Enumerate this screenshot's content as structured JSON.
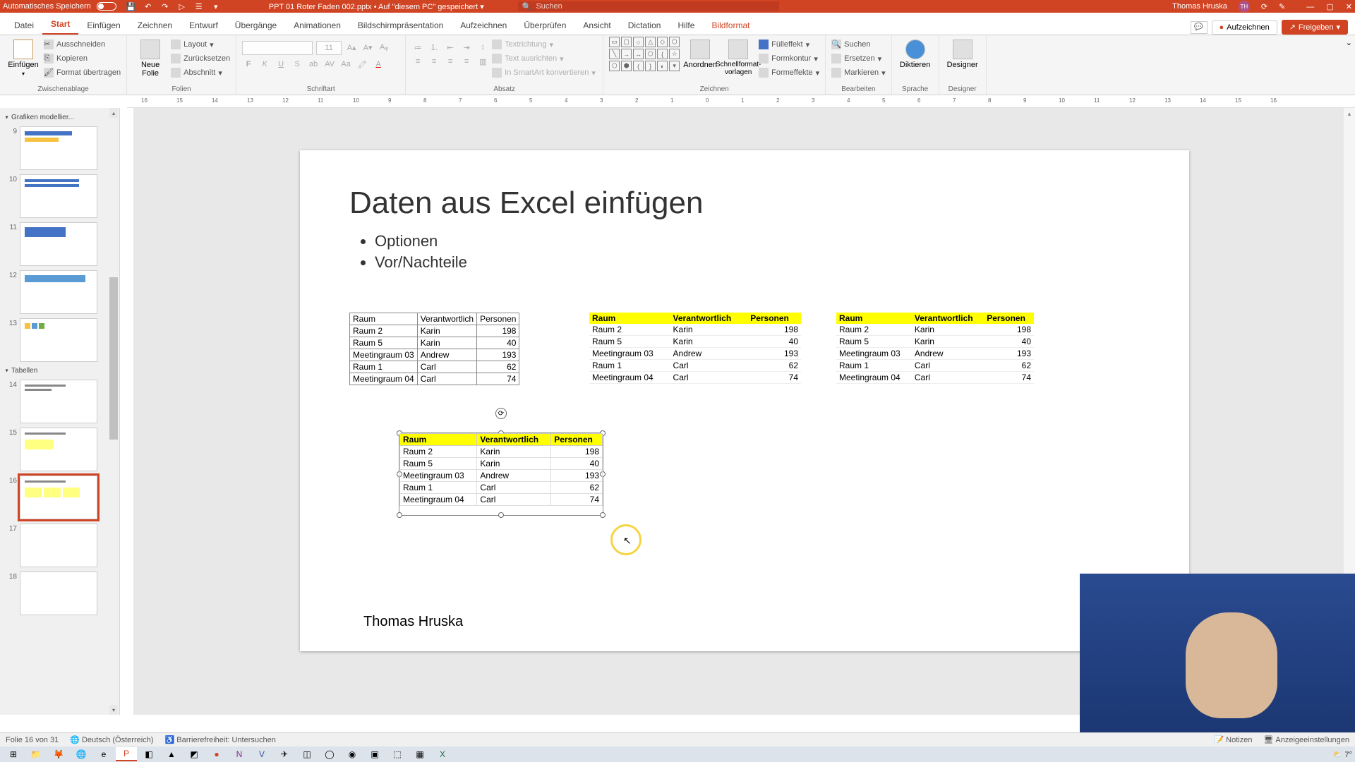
{
  "titlebar": {
    "autosave": "Automatisches Speichern",
    "filename": "PPT 01 Roter Faden 002.pptx",
    "saved_hint": "Auf \"diesem PC\" gespeichert",
    "search_placeholder": "Suchen",
    "user": "Thomas Hruska",
    "user_initials": "TH"
  },
  "tabs": [
    "Datei",
    "Start",
    "Einfügen",
    "Zeichnen",
    "Entwurf",
    "Übergänge",
    "Animationen",
    "Bildschirmpräsentation",
    "Aufzeichnen",
    "Überprüfen",
    "Ansicht",
    "Dictation",
    "Hilfe",
    "Bildformat"
  ],
  "active_tab": "Start",
  "context_tab": "Bildformat",
  "tab_right": {
    "record": "Aufzeichnen",
    "share": "Freigeben"
  },
  "ribbon": {
    "clipboard": {
      "paste": "Einfügen",
      "cut": "Ausschneiden",
      "copy": "Kopieren",
      "fmt": "Format übertragen",
      "label": "Zwischenablage"
    },
    "slides": {
      "new": "Neue\nFolie",
      "layout": "Layout",
      "reset": "Zurücksetzen",
      "section": "Abschnitt",
      "label": "Folien"
    },
    "font": {
      "size": "11",
      "label": "Schriftart"
    },
    "paragraph": {
      "textdir": "Textrichtung",
      "align": "Text ausrichten",
      "smartart": "In SmartArt konvertieren",
      "label": "Absatz"
    },
    "drawing": {
      "arrange": "Anordnen",
      "quick": "Schnellformat-\nvorlagen",
      "fill": "Fülleffekt",
      "outline": "Formkontur",
      "effects": "Formeffekte",
      "label": "Zeichnen"
    },
    "editing": {
      "find": "Suchen",
      "replace": "Ersetzen",
      "select": "Markieren",
      "label": "Bearbeiten"
    },
    "voice": {
      "dictate": "Diktieren",
      "label": "Sprache"
    },
    "designer": {
      "btn": "Designer",
      "label": "Designer"
    }
  },
  "sections": {
    "s1": "Grafiken modellier...",
    "s2": "Tabellen"
  },
  "thumbs": [
    {
      "n": "9"
    },
    {
      "n": "10"
    },
    {
      "n": "11"
    },
    {
      "n": "12"
    },
    {
      "n": "13"
    },
    {
      "n": "14"
    },
    {
      "n": "15"
    },
    {
      "n": "16"
    },
    {
      "n": "17"
    },
    {
      "n": "18"
    }
  ],
  "slide": {
    "title": "Daten aus Excel einfügen",
    "bullets": [
      "Optionen",
      "Vor/Nachteile"
    ],
    "author": "Thomas Hruska",
    "table_headers": [
      "Raum",
      "Verantwortlich",
      "Personen"
    ],
    "table_rows": [
      [
        "Raum 2",
        "Karin",
        "198"
      ],
      [
        "Raum 5",
        "Karin",
        "40"
      ],
      [
        "Meetingraum 03",
        "Andrew",
        "193"
      ],
      [
        "Raum 1",
        "Carl",
        "62"
      ],
      [
        "Meetingraum 04",
        "Carl",
        "74"
      ]
    ]
  },
  "status": {
    "slide": "Folie 16 von 31",
    "lang": "Deutsch (Österreich)",
    "access": "Barrierefreiheit: Untersuchen",
    "notes": "Notizen",
    "display": "Anzeigeeinstellungen"
  },
  "taskbar": {
    "temp": "7°"
  }
}
